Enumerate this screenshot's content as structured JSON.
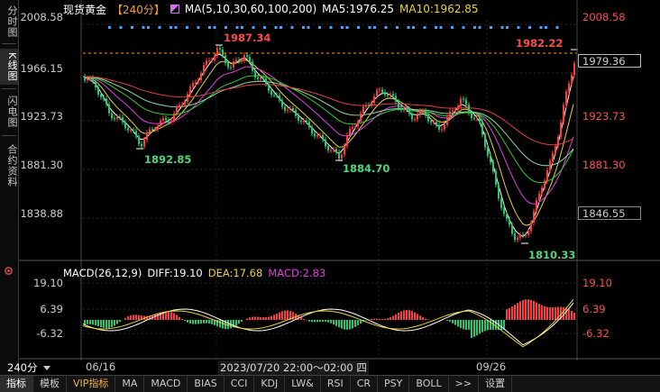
{
  "sidebar": {
    "tabs": [
      {
        "label": "分时图"
      },
      {
        "label": "K线图"
      },
      {
        "label": "闪电图"
      },
      {
        "label": "合约资料"
      }
    ]
  },
  "header": {
    "symbol": "现货黄金",
    "period_bracket": "【240分】",
    "ma_label": "MA(5,10,30,60,100,200)",
    "ma5_text": "MA5:1976.25",
    "ma10_text": "MA10:1962.85"
  },
  "price_axis": {
    "left_labels": [
      "2008.58",
      "1966.15",
      "1923.73",
      "1881.30",
      "1838.88"
    ],
    "right_labels": [
      "2008.58",
      "1923.73",
      "1881.30"
    ],
    "current_price": "1979.36",
    "low_box": "1846.55"
  },
  "annotations": {
    "high1": "1987.34",
    "high2": "1982.22",
    "low1": "1892.85",
    "low2": "1884.70",
    "low3": "1810.33"
  },
  "macd": {
    "label": "MACD(26,12,9)",
    "diff": "DIFF:19.10",
    "dea": "DEA:17.68",
    "macd": "MACD:2.83",
    "left_labels": [
      "19.10",
      "6.39",
      "-6.32"
    ],
    "right_labels": [
      "19.10",
      "6.39",
      "-6.32"
    ]
  },
  "x_axis": {
    "period": "240分",
    "date1": "06/16",
    "tooltip": "2023/07/20 22:00～02:00 四",
    "date2": "09/26"
  },
  "bottom_tabs": [
    {
      "label": "指标"
    },
    {
      "label": "模板"
    },
    {
      "label": "VIP指标"
    },
    {
      "label": "MA"
    },
    {
      "label": "MACD"
    },
    {
      "label": "BIAS"
    },
    {
      "label": "CCI"
    },
    {
      "label": "KDJ"
    },
    {
      "label": "LW&"
    },
    {
      "label": "RSI"
    },
    {
      "label": "CR"
    },
    {
      "label": "PSY"
    },
    {
      "label": "BOLL"
    },
    {
      "label": ">>"
    },
    {
      "label": "设置"
    }
  ],
  "colors": {
    "up": "#ff3b3b",
    "down": "#27c96f",
    "ma5": "#ffffff",
    "ma10": "#e8d23a",
    "ma30": "#e040e0",
    "ma60": "#33cc33",
    "ma100": "#8fd8a0",
    "ma200": "#e04040",
    "dea": "#e8d23a",
    "diff": "#ffffff",
    "macd_line": "#e040e0"
  }
}
